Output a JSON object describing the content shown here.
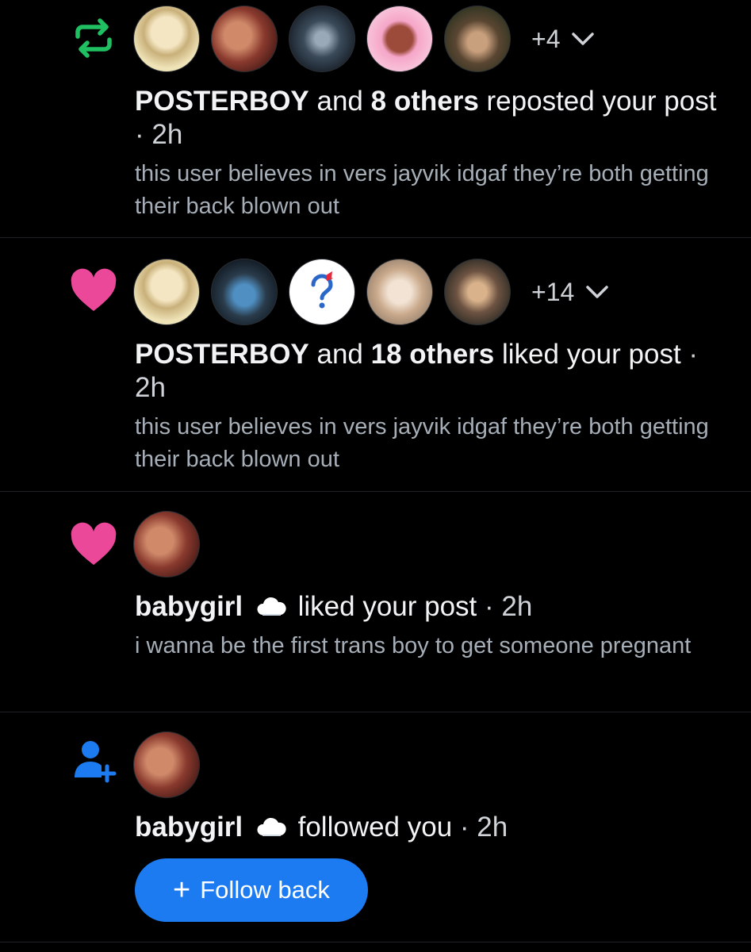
{
  "notifications": [
    {
      "type": "repost",
      "icon": "repost-icon",
      "avatars": [
        "avatar-1",
        "avatar-2",
        "avatar-3",
        "avatar-4",
        "avatar-5"
      ],
      "more": "+4",
      "actor": "POSTERBOY",
      "and": "and",
      "others": "8 others",
      "action": "reposted your post",
      "time": "· 2h",
      "snippet": "this user believes in vers jayvik idgaf they’re both getting their back blown out"
    },
    {
      "type": "like",
      "icon": "heart-icon",
      "avatars": [
        "avatar-1",
        "avatar-2",
        "avatar-3",
        "avatar-4",
        "avatar-5"
      ],
      "more": "+14",
      "actor": "POSTERBOY",
      "and": "and",
      "others": "18 others",
      "action": "liked your post",
      "time": "· 2h",
      "snippet": "this user believes in vers jayvik idgaf they’re both getting their back blown out"
    },
    {
      "type": "like",
      "icon": "heart-icon",
      "actor": "babygirl",
      "action": "liked your post",
      "time": "· 2h",
      "snippet": "i wanna be the first trans boy to get someone pregnant"
    },
    {
      "type": "follow",
      "icon": "add-user-icon",
      "actor": "babygirl",
      "action": "followed you",
      "time": "· 2h",
      "button_label": "Follow back"
    }
  ],
  "colors": {
    "background": "#000000",
    "repost": "#20c062",
    "heart": "#ec4899",
    "accent": "#1d7bf2",
    "secondary_text": "#a6aeb7"
  }
}
